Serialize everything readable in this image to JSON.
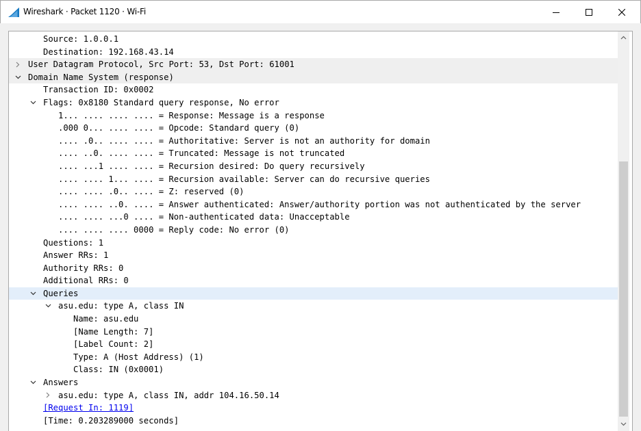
{
  "window": {
    "title": "Wireshark · Packet 1120 · Wi-Fi",
    "icons": {
      "app": "wireshark-shark-fin-icon",
      "minimize": "minimize-icon",
      "maximize": "maximize-icon",
      "close": "close-icon"
    }
  },
  "tree": [
    {
      "level": 1,
      "expander": "none",
      "text": "Source: 1.0.0.1"
    },
    {
      "level": 1,
      "expander": "none",
      "text": "Destination: 192.168.43.14"
    },
    {
      "level": 0,
      "expander": "collapsed",
      "shaded": true,
      "text": "User Datagram Protocol, Src Port: 53, Dst Port: 61001"
    },
    {
      "level": 0,
      "expander": "expanded",
      "shaded": true,
      "text": "Domain Name System (response)"
    },
    {
      "level": 1,
      "expander": "none",
      "text": "Transaction ID: 0x0002"
    },
    {
      "level": 1,
      "expander": "expanded",
      "text": "Flags: 0x8180 Standard query response, No error"
    },
    {
      "level": 2,
      "expander": "none",
      "text": "1... .... .... .... = Response: Message is a response"
    },
    {
      "level": 2,
      "expander": "none",
      "text": ".000 0... .... .... = Opcode: Standard query (0)"
    },
    {
      "level": 2,
      "expander": "none",
      "text": ".... .0.. .... .... = Authoritative: Server is not an authority for domain"
    },
    {
      "level": 2,
      "expander": "none",
      "text": ".... ..0. .... .... = Truncated: Message is not truncated"
    },
    {
      "level": 2,
      "expander": "none",
      "text": ".... ...1 .... .... = Recursion desired: Do query recursively"
    },
    {
      "level": 2,
      "expander": "none",
      "text": ".... .... 1... .... = Recursion available: Server can do recursive queries"
    },
    {
      "level": 2,
      "expander": "none",
      "text": ".... .... .0.. .... = Z: reserved (0)"
    },
    {
      "level": 2,
      "expander": "none",
      "text": ".... .... ..0. .... = Answer authenticated: Answer/authority portion was not authenticated by the server"
    },
    {
      "level": 2,
      "expander": "none",
      "text": ".... .... ...0 .... = Non-authenticated data: Unacceptable"
    },
    {
      "level": 2,
      "expander": "none",
      "text": ".... .... .... 0000 = Reply code: No error (0)"
    },
    {
      "level": 1,
      "expander": "none",
      "text": "Questions: 1"
    },
    {
      "level": 1,
      "expander": "none",
      "text": "Answer RRs: 1"
    },
    {
      "level": 1,
      "expander": "none",
      "text": "Authority RRs: 0"
    },
    {
      "level": 1,
      "expander": "none",
      "text": "Additional RRs: 0"
    },
    {
      "level": 1,
      "expander": "expanded",
      "selected": true,
      "text": "Queries"
    },
    {
      "level": 2,
      "expander": "expanded",
      "text": "asu.edu: type A, class IN"
    },
    {
      "level": 3,
      "expander": "none",
      "text": "Name: asu.edu"
    },
    {
      "level": 3,
      "expander": "none",
      "text": "[Name Length: 7]"
    },
    {
      "level": 3,
      "expander": "none",
      "text": "[Label Count: 2]"
    },
    {
      "level": 3,
      "expander": "none",
      "text": "Type: A (Host Address) (1)"
    },
    {
      "level": 3,
      "expander": "none",
      "text": "Class: IN (0x0001)"
    },
    {
      "level": 1,
      "expander": "expanded",
      "text": "Answers"
    },
    {
      "level": 2,
      "expander": "collapsed",
      "text": "asu.edu: type A, class IN, addr 104.16.50.14"
    },
    {
      "level": 1,
      "expander": "none",
      "link": true,
      "text": "[Request In: 1119]"
    },
    {
      "level": 1,
      "expander": "none",
      "text": "[Time: 0.203289000 seconds]"
    }
  ],
  "colors": {
    "shaded_row": "#efefef",
    "selected_row": "#e3eefa",
    "link": "#0000ee",
    "wireshark_blue": "#1679c2"
  }
}
